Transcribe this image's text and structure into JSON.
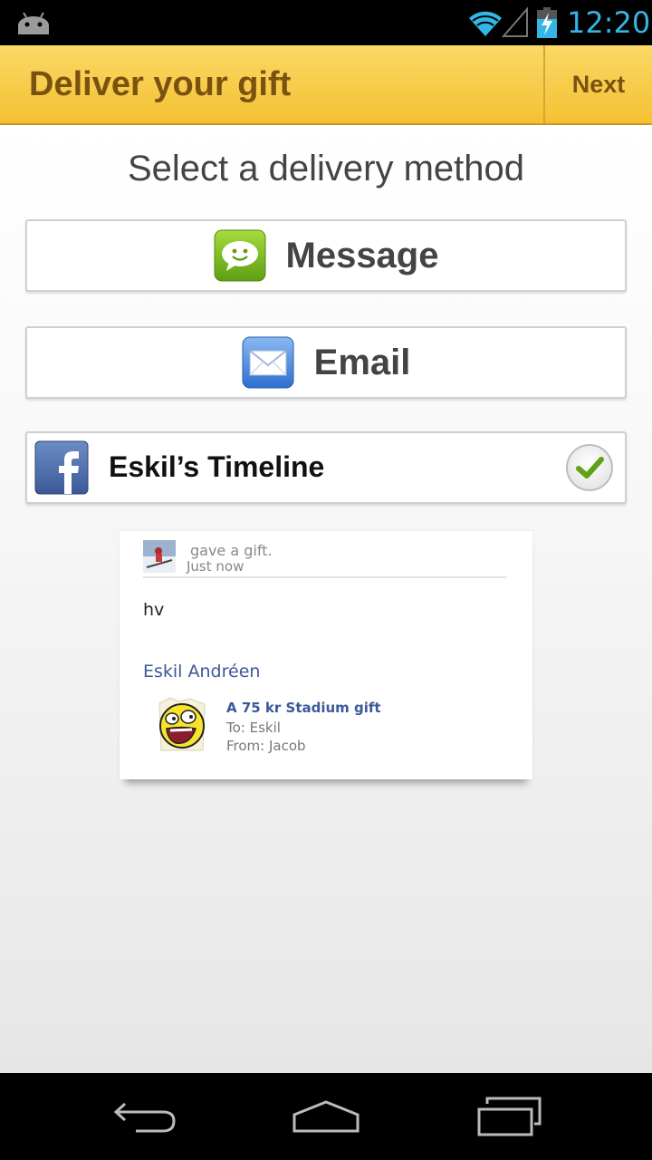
{
  "status_bar": {
    "time": "12:20",
    "icons": [
      "android-icon",
      "wifi-icon",
      "signal-icon",
      "battery-charging-icon"
    ],
    "clock_color": "#33b5e5"
  },
  "action_bar": {
    "title": "Deliver your gift",
    "next_label": "Next",
    "background": "#f4c132",
    "text_color": "#7a5210"
  },
  "main": {
    "heading": "Select a delivery method",
    "methods": [
      {
        "label": "Message",
        "icon": "message-icon",
        "selected": false
      },
      {
        "label": "Email",
        "icon": "email-icon",
        "selected": false
      },
      {
        "label": "Eskil’s Timeline",
        "icon": "facebook-icon",
        "selected": true
      }
    ]
  },
  "preview": {
    "story": "gave a gift.",
    "time": "Just now",
    "message": "hv",
    "recipient": "Eskil Andréen",
    "gift_title": "A 75 kr Stadium gift",
    "gift_to": "To: Eskil",
    "gift_from": "From: Jacob",
    "link_color": "#3b5998"
  },
  "nav_bar": {
    "icons": [
      "back-icon",
      "home-icon",
      "recents-icon"
    ]
  }
}
